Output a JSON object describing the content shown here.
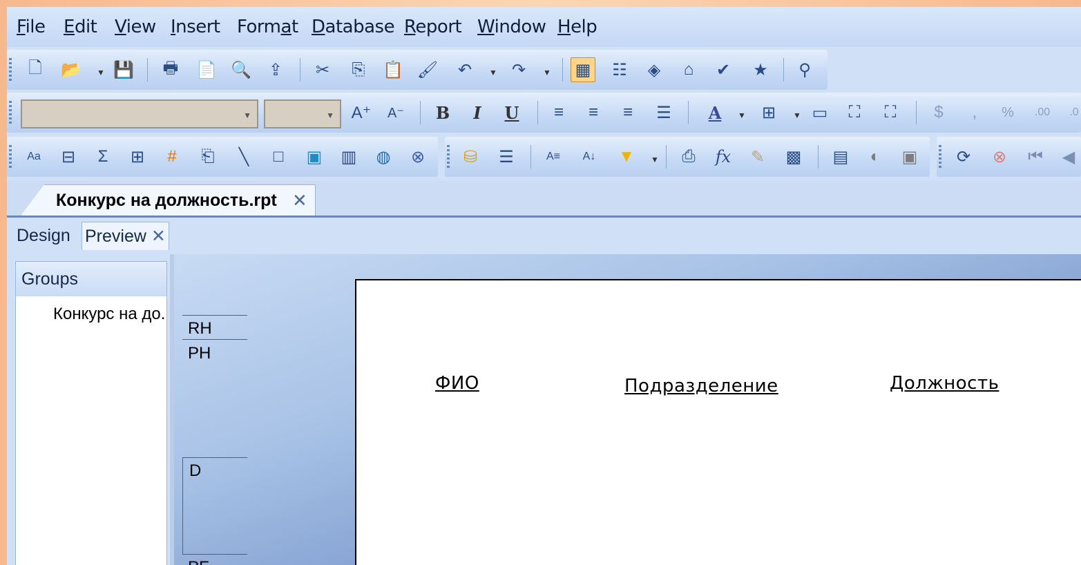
{
  "menu": {
    "items": [
      {
        "pre": "",
        "u": "F",
        "post": "ile"
      },
      {
        "pre": "",
        "u": "E",
        "post": "dit"
      },
      {
        "pre": "",
        "u": "V",
        "post": "iew"
      },
      {
        "pre": "",
        "u": "I",
        "post": "nsert"
      },
      {
        "pre": "Form",
        "u": "a",
        "post": "t"
      },
      {
        "pre": "",
        "u": "D",
        "post": "atabase"
      },
      {
        "pre": "",
        "u": "R",
        "post": "eport"
      },
      {
        "pre": "",
        "u": "W",
        "post": "indow"
      },
      {
        "pre": "",
        "u": "H",
        "post": "elp"
      }
    ]
  },
  "toolbar_format": {
    "bold": "B",
    "italic": "I",
    "underline": "U",
    "font_color": "A",
    "currency": "$",
    "comma": ",",
    "percent": "%"
  },
  "document": {
    "tab_label": "Конкурс на должность.rpt",
    "close": "✕"
  },
  "view_tabs": {
    "design": "Design",
    "preview": "Preview",
    "preview_close": "✕"
  },
  "groups": {
    "header": "Groups",
    "item": "Конкурс на до."
  },
  "sections": {
    "rh": "RH",
    "ph": "PH",
    "d": "D",
    "pf": "PF"
  },
  "report": {
    "col1": "ФИО",
    "col2": "Подразделение",
    "col3": "Должность"
  },
  "colors": {
    "accent_active": "#fbd58a",
    "window_bg": "#cfe0f7",
    "slide_border": "#f7b98c"
  }
}
